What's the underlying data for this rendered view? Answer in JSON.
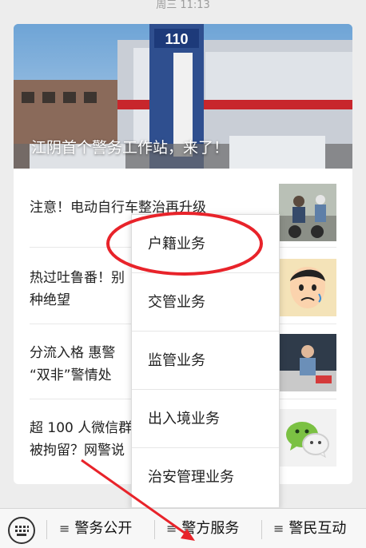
{
  "status_bar": {
    "time": "周三 11:13"
  },
  "hero": {
    "title": "江阴首个警务工作站，来了！",
    "sign_number": "110"
  },
  "news": [
    {
      "title": "注意！电动自行车整治再升级"
    },
    {
      "title": "热过吐鲁番！别\n种绝望"
    },
    {
      "title": "分流入格 惠警\n“双非”警情处"
    },
    {
      "title": "超 100 人微信群\n被拘留？网警说"
    }
  ],
  "popup_menu": {
    "items": [
      {
        "label": "户籍业务",
        "highlighted": true
      },
      {
        "label": "交管业务"
      },
      {
        "label": "监管业务"
      },
      {
        "label": "出入境业务"
      },
      {
        "label": "治安管理业务"
      }
    ]
  },
  "bottom_bar": {
    "tabs": [
      {
        "label": "警务公开"
      },
      {
        "label": "警方服务"
      },
      {
        "label": "警民互动"
      }
    ]
  },
  "annotation": {
    "highlight_color": "#e8232a"
  }
}
